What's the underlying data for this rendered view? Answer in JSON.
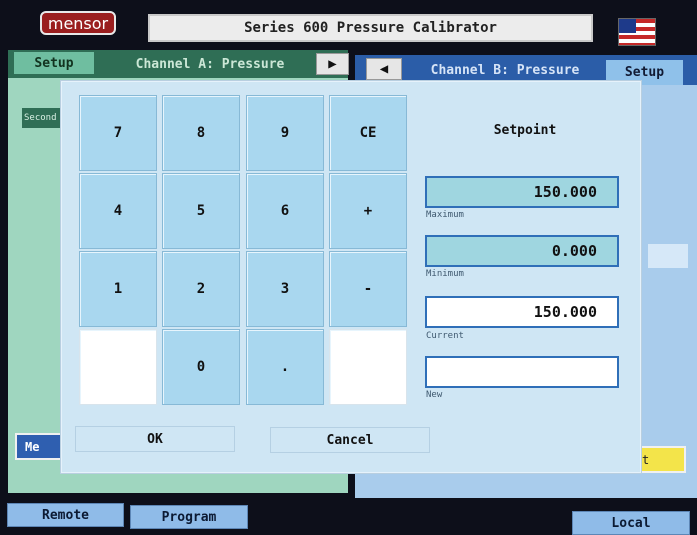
{
  "header": {
    "logo": "mensor",
    "title": "Series 600 Pressure Calibrator",
    "flag_icon": "us-flag-icon"
  },
  "channel_a": {
    "setup_label": "Setup",
    "title": "Channel A: Pressure",
    "arrow_icon": "right-arrow-icon",
    "second_label": "Second",
    "measure_label": "Me",
    "colors": {
      "panel": "#9fd6bf",
      "header": "#2f6e55"
    }
  },
  "channel_b": {
    "setup_label": "Setup",
    "title": "Channel B: Pressure",
    "arrow_icon": "left-arrow-icon",
    "yellow_button_label": "t",
    "colors": {
      "panel": "#a9ccec",
      "header": "#2b5da8"
    }
  },
  "keypad": {
    "keys": [
      "7",
      "8",
      "9",
      "CE",
      "4",
      "5",
      "6",
      "+",
      "1",
      "2",
      "3",
      "-",
      "",
      "0",
      ".",
      ""
    ]
  },
  "setpoint": {
    "title": "Setpoint",
    "maximum_value": "150.000",
    "maximum_label": "Maximum",
    "minimum_value": "0.000",
    "minimum_label": "Minimum",
    "current_value": "150.000",
    "current_label": "Current",
    "new_value": "",
    "new_label": "New"
  },
  "dialog_buttons": {
    "ok_label": "OK",
    "cancel_label": "Cancel"
  },
  "footer": {
    "remote_label": "Remote",
    "program_label": "Program",
    "local_label": "Local"
  }
}
